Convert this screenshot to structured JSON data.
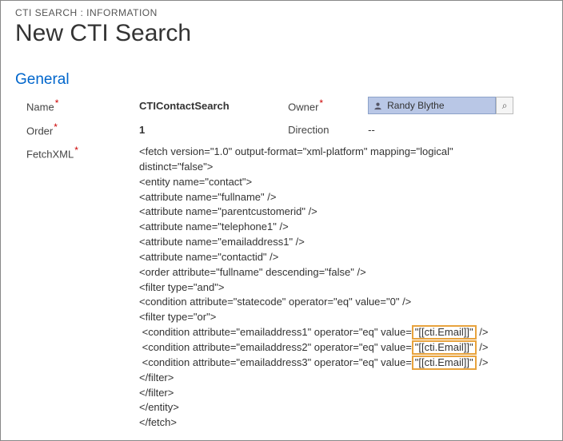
{
  "breadcrumb": "CTI SEARCH : INFORMATION",
  "page_title": "New CTI Search",
  "section": "General",
  "labels": {
    "name": "Name",
    "owner": "Owner",
    "order": "Order",
    "direction": "Direction",
    "fetchxml": "FetchXML"
  },
  "required_mark": "*",
  "values": {
    "name": "CTIContactSearch",
    "order": "1",
    "direction": "--",
    "owner": "Randy Blythe"
  },
  "icons": {
    "lookup": "⌕"
  },
  "fetchxml": {
    "lines": [
      "<fetch version=\"1.0\" output-format=\"xml-platform\" mapping=\"logical\"",
      "distinct=\"false\">",
      "<entity name=\"contact\">",
      "<attribute name=\"fullname\" />",
      "<attribute name=\"parentcustomerid\" />",
      "<attribute name=\"telephone1\" />",
      "<attribute name=\"emailaddress1\" />",
      "<attribute name=\"contactid\" />",
      "<order attribute=\"fullname\" descending=\"false\" />",
      "<filter type=\"and\">",
      "<condition attribute=\"statecode\" operator=\"eq\" value=\"0\" />",
      "<filter type=\"or\">"
    ],
    "highlighted": [
      {
        "pre": " <condition attribute=\"emailaddress1\" operator=\"eq\" value=",
        "hl": "\"[[cti.Email]]\"",
        "post": " />"
      },
      {
        "pre": " <condition attribute=\"emailaddress2\" operator=\"eq\" value=",
        "hl": "\"[[cti.Email]]\"",
        "post": " />"
      },
      {
        "pre": " <condition attribute=\"emailaddress3\" operator=\"eq\" value=",
        "hl": "\"[[cti.Email]]\"",
        "post": " />"
      }
    ],
    "closing": [
      "</filter>",
      "</filter>",
      "</entity>",
      "</fetch>"
    ]
  }
}
